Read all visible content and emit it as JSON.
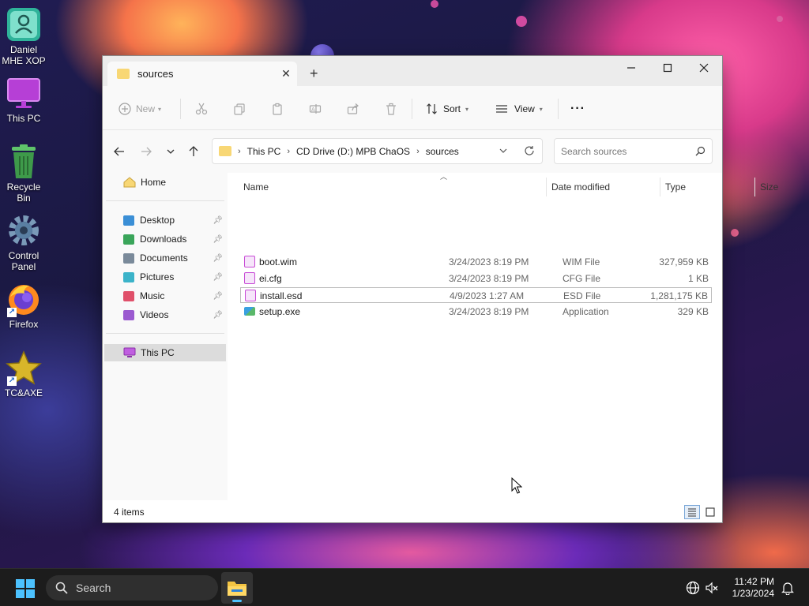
{
  "desktop": {
    "icons": [
      {
        "label": "Daniel MHE XOP",
        "icon": "user-folder-icon"
      },
      {
        "label": "This PC",
        "icon": "monitor-icon"
      },
      {
        "label": "Recycle Bin",
        "icon": "recycle-bin-icon"
      },
      {
        "label": "Control Panel",
        "icon": "gear-icon"
      },
      {
        "label": "Firefox",
        "icon": "firefox-icon"
      },
      {
        "label": "TC&AXE",
        "icon": "star-icon"
      }
    ]
  },
  "window": {
    "tab_title": "sources",
    "new_tab_symbol": "+",
    "toolbar": {
      "new_label": "New",
      "sort_label": "Sort",
      "view_label": "View",
      "more_symbol": "···"
    },
    "breadcrumb": [
      "This PC",
      "CD Drive (D:) MPB ChaOS",
      "sources"
    ],
    "search_placeholder": "Search sources",
    "nav": {
      "home": "Home",
      "quick_access": [
        {
          "label": "Desktop",
          "color": "#3b8fd6"
        },
        {
          "label": "Downloads",
          "color": "#3aa55a"
        },
        {
          "label": "Documents",
          "color": "#7a8a9a"
        },
        {
          "label": "Pictures",
          "color": "#3bb3c9"
        },
        {
          "label": "Music",
          "color": "#e0506a"
        },
        {
          "label": "Videos",
          "color": "#9b5ad0"
        }
      ],
      "this_pc": "This PC"
    },
    "columns": {
      "name": "Name",
      "date": "Date modified",
      "type": "Type",
      "size": "Size"
    },
    "files": [
      {
        "name": "boot.wim",
        "date": "3/24/2023 8:19 PM",
        "type": "WIM File",
        "size": "327,959 KB"
      },
      {
        "name": "ei.cfg",
        "date": "3/24/2023 8:19 PM",
        "type": "CFG File",
        "size": "1 KB"
      },
      {
        "name": "install.esd",
        "date": "4/9/2023 1:27 AM",
        "type": "ESD File",
        "size": "1,281,175 KB"
      },
      {
        "name": "setup.exe",
        "date": "3/24/2023 8:19 PM",
        "type": "Application",
        "size": "329 KB"
      }
    ],
    "status": "4 items"
  },
  "taskbar": {
    "search_label": "Search",
    "time": "11:42 PM",
    "date": "1/23/2024"
  }
}
